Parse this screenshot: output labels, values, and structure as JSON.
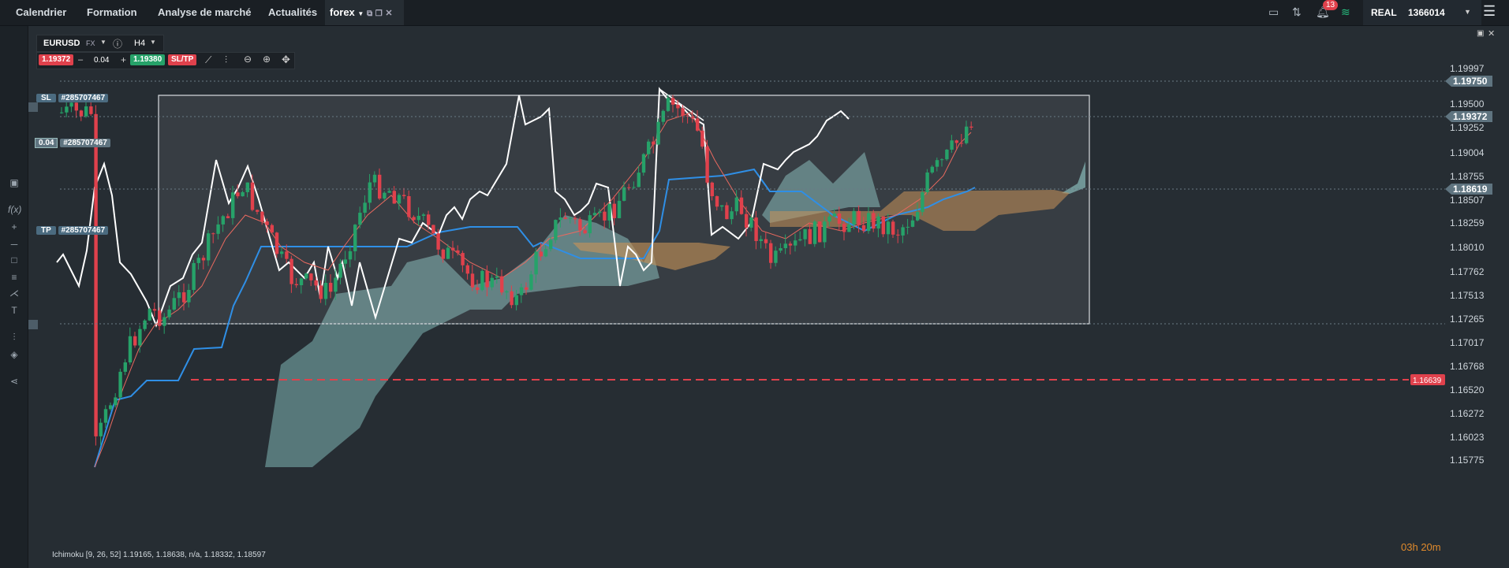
{
  "topbar": {
    "nav": [
      "Calendrier",
      "Formation",
      "Analyse de marché",
      "Actualités"
    ],
    "active_tab": "forex",
    "notifications": "13",
    "account_type": "REAL",
    "account_id": "1366014"
  },
  "toolbar": {
    "symbol": "EURUSD",
    "market": "FX",
    "timeframe": "H4",
    "bid": "1.19372",
    "minus": "–",
    "volume": "0.04",
    "plus": "+",
    "ask": "1.19380",
    "sltp": "SL/TP"
  },
  "orders": {
    "sl_tag": "SL",
    "sl_id": "#285707467",
    "pos_vol": "0.04",
    "pos_id": "#285707467",
    "tp_tag": "TP",
    "tp_id": "#285707467"
  },
  "price_axis": [
    "1.19997",
    "1.19750",
    "1.19500",
    "1.19372",
    "1.19252",
    "1.19004",
    "1.18755",
    "1.18619",
    "1.18507",
    "1.18259",
    "1.18010",
    "1.17762",
    "1.17513",
    "1.17265",
    "1.17017",
    "1.16768",
    "1.16639",
    "1.16520",
    "1.16272",
    "1.16023",
    "1.15775"
  ],
  "price_tags": {
    "sl": "1.19750",
    "current": "1.19372",
    "tp": "1.18619",
    "alert": "1.16639"
  },
  "indicator_text": "Ichimoku [9, 26, 52] 1.19165, 1.18638, n/a, 1.18332, 1.18597",
  "countdown": {
    "h": "03h",
    "m": "20m"
  },
  "colors": {
    "bull": "#26a269",
    "bear": "#e0414c",
    "tenkan_white": "#ffffff",
    "kijun": "#2f8fe6",
    "cloud_green": "#7fb7b5",
    "cloud_orange": "#c48a4a",
    "alert": "#e0414c"
  },
  "icons": [
    "layout-icon",
    "signal-icon",
    "bell-icon",
    "wifi-icon",
    "chevron-down-icon",
    "menu-icon",
    "info-icon",
    "settings-icon",
    "zoom-out-icon",
    "zoom-in-icon",
    "crosshair-icon"
  ]
}
